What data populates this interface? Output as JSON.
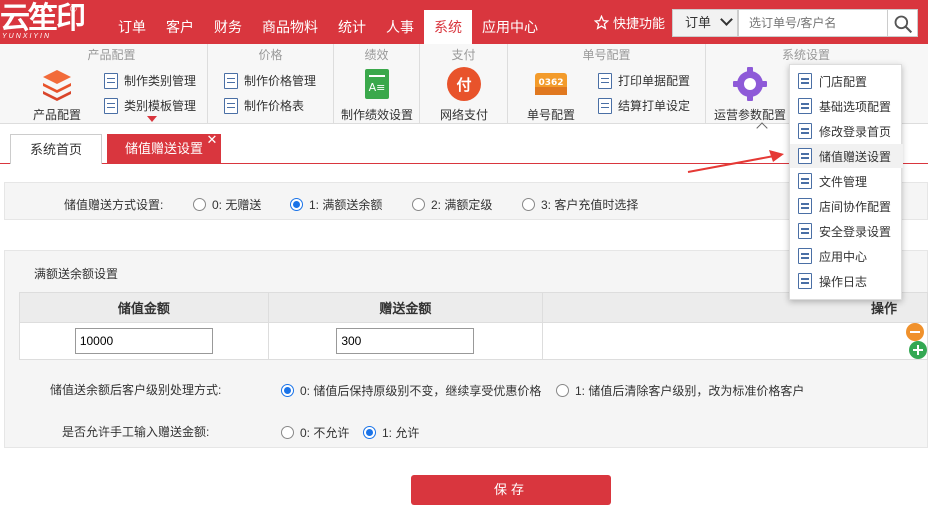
{
  "brand": {
    "name": "云笙印",
    "sub": "YUNXIYIN",
    "reg": "®",
    "accent": "#d9363e"
  },
  "nav": [
    "订单",
    "客户",
    "财务",
    "商品物料",
    "统计",
    "人事",
    "系统",
    "应用中心"
  ],
  "quick": {
    "label": "快捷功能"
  },
  "search": {
    "scope": "订单",
    "placeholder": "选订单号/客户名"
  },
  "ribbon": {
    "product": {
      "title": "产品配置",
      "big": "产品配置",
      "items": [
        "制作类别管理",
        "类别模板管理"
      ]
    },
    "price": {
      "title": "价格",
      "items": [
        "制作价格管理",
        "制作价格表"
      ]
    },
    "perf": {
      "title": "绩效",
      "big": "制作绩效设置"
    },
    "pay": {
      "title": "支付",
      "big": "网络支付"
    },
    "number": {
      "title": "单号配置",
      "big": "单号配置",
      "icon_text": "0362",
      "items": [
        "打印单据配置",
        "结算打单设定"
      ]
    },
    "system": {
      "title": "系统设置",
      "big": "运营参数配置"
    }
  },
  "tabs": {
    "home": "系统首页",
    "current": "储值赠送设置"
  },
  "gift_mode": {
    "label": "储值赠送方式设置:",
    "options": [
      "0: 无赠送",
      "1: 满额送余额",
      "2: 满额定级",
      "3: 客户充值时选择"
    ],
    "selected": 1
  },
  "amount": {
    "title": "满额送余额设置",
    "headers": [
      "储值金额",
      "赠送金额",
      "操作"
    ],
    "rows": [
      {
        "deposit": "10000",
        "gift": "300"
      }
    ]
  },
  "level_rule": {
    "label": "储值送余额后客户级别处理方式:",
    "options": [
      "0: 储值后保持原级别不变，继续享受优惠价格",
      "1: 储值后清除客户级别，改为标准价格客户"
    ],
    "selected": 0
  },
  "manual": {
    "label": "是否允许手工输入赠送金额:",
    "options": [
      "0: 不允许",
      "1: 允许"
    ],
    "selected": 1
  },
  "save_label": "保存",
  "menu": [
    "门店配置",
    "基础选项配置",
    "修改登录首页",
    "储值赠送设置",
    "文件管理",
    "店间协作配置",
    "安全登录设置",
    "应用中心",
    "操作日志"
  ],
  "menu_highlight": 3
}
